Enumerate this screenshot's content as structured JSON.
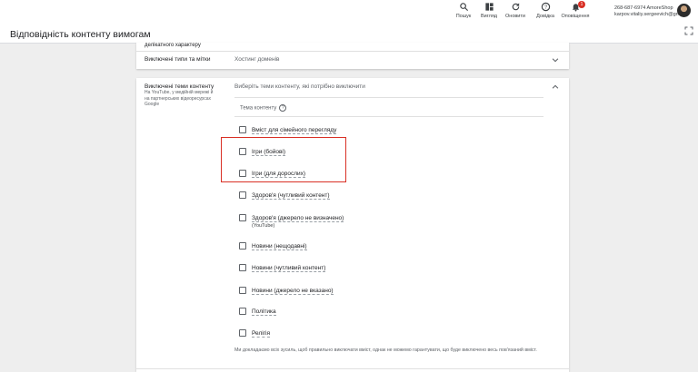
{
  "toolbar": {
    "search_label": "Пошук",
    "view_label": "Вигляд",
    "refresh_label": "Оновити",
    "help_label": "Довідка",
    "notifications_label": "Оповіщення",
    "notifications_count": "1"
  },
  "account": {
    "line1": "268-687-6974 AmoreShop",
    "line2": "karpov.vitaliy.sergeevich@gm..."
  },
  "page": {
    "title": "Відповідність контенту вимогам"
  },
  "card1": {
    "truncated_text": "делікатного характеру",
    "row_label": "Виключені типи та мітки",
    "row_value": "Хостинг доменів"
  },
  "card2": {
    "heading": "Виключені теми контенту",
    "subtext": "На YouTube, у медійній мережі й на партнерських відеоресурсах Google",
    "prompt": "Виберіть теми контенту, які потрібно виключити",
    "column_header": "Тема контенту",
    "options": [
      {
        "label": "Вміст для сімейного перегляду",
        "sub": ""
      },
      {
        "label": "Ігри (бойові)",
        "sub": ""
      },
      {
        "label": "Ігри (для дорослих)",
        "sub": ""
      },
      {
        "label": "Здоров'я (чутливий контент)",
        "sub": ""
      },
      {
        "label": "Здоров'я (джерело не визначено)",
        "sub": "(YouTube)"
      },
      {
        "label": "Новини (нещодавні)",
        "sub": ""
      },
      {
        "label": "Новини (чутливий контент)",
        "sub": ""
      },
      {
        "label": "Новини (джерело не вказано)",
        "sub": ""
      },
      {
        "label": "Політика",
        "sub": ""
      },
      {
        "label": "Релігія",
        "sub": ""
      }
    ],
    "footnote": "Ми докладаємо всіх зусиль, щоб правильно виключати вміст, однак не можемо гарантувати, що буде виключено весь пов'язаний вміст."
  },
  "colors": {
    "highlight_box": "#d93025",
    "background": "#eeeeee"
  }
}
